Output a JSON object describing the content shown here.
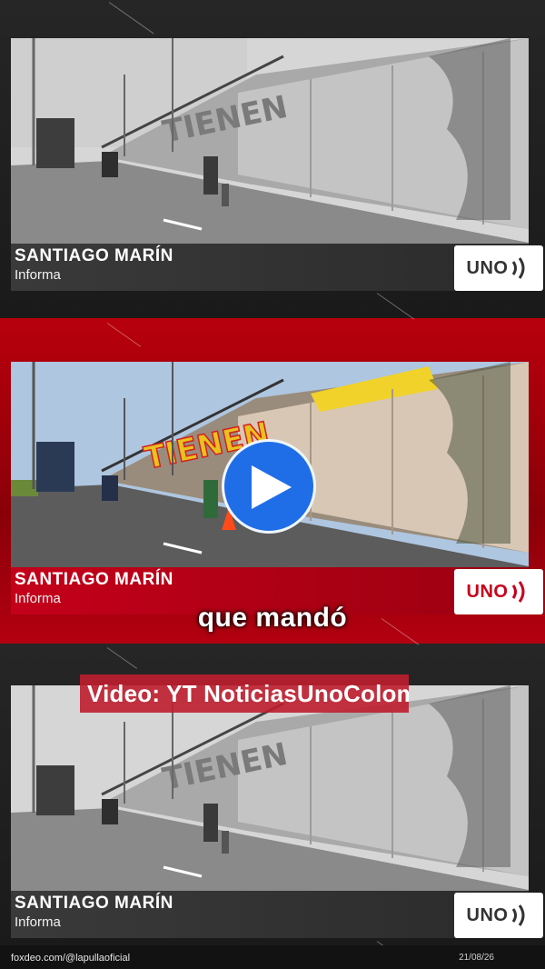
{
  "panels": [
    {
      "reporter_name": "SANTIAGO MARÍN",
      "reporter_role": "Informa",
      "logo_text": "UNO",
      "style": "gray"
    },
    {
      "reporter_name": "SANTIAGO MARÍN",
      "reporter_role": "Informa",
      "logo_text": "UNO",
      "style": "color"
    },
    {
      "reporter_name": "SANTIAGO MARÍN",
      "reporter_role": "Informa",
      "logo_text": "UNO",
      "style": "gray"
    }
  ],
  "caption": "que mandó",
  "video_credit": "Video: YT NoticiasUnoColom",
  "mural_text": "TIENEN",
  "footer": {
    "handle": "foxdeo.com/@lapullaoficial",
    "date": "21/08/26"
  },
  "icons": {
    "play": "play-icon",
    "logo": "uno-logo-icon"
  },
  "colors": {
    "accent_red": "#b8000d",
    "play_blue": "#1f6ee8",
    "dark_bg": "#1c1c1c"
  }
}
